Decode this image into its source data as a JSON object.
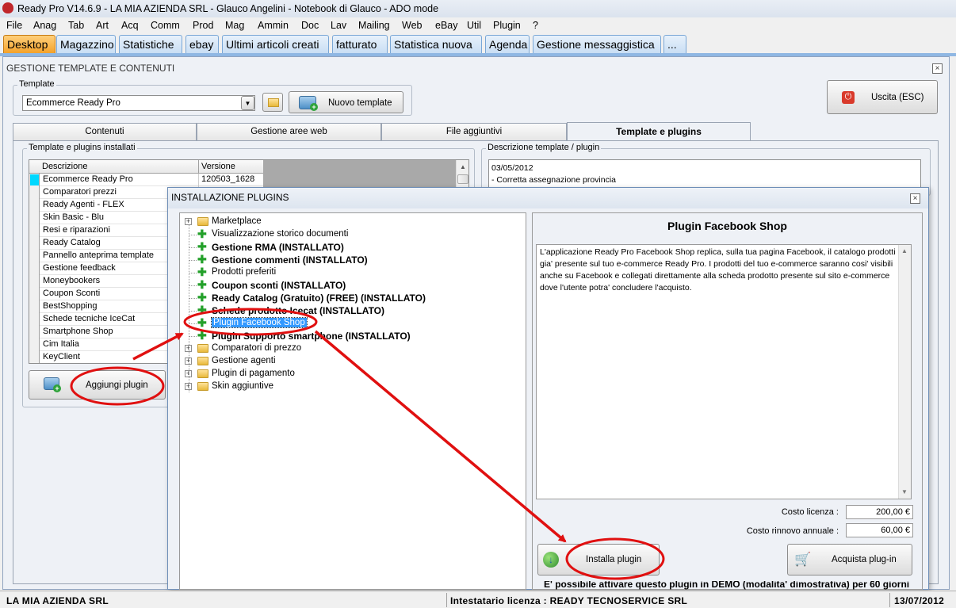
{
  "window": {
    "title": "Ready Pro V14.6.9 - LA MIA AZIENDA SRL - Glauco Angelini - Notebook di Glauco - ADO mode"
  },
  "menu": [
    "File",
    "Anag",
    "Tab",
    "Art",
    "Acq",
    "Comm",
    "Prod",
    "Mag",
    "Ammin",
    "Doc",
    "Lav",
    "Mailing",
    "Web",
    "eBay",
    "Util",
    "Plugin",
    "?"
  ],
  "tabs": [
    "Desktop",
    "Magazzino",
    "Statistiche",
    "ebay",
    "Ultimi articoli creati",
    "fatturato",
    "Statistica nuova",
    "Agenda",
    "Gestione messaggistica",
    "..."
  ],
  "main": {
    "title": "GESTIONE TEMPLATE E CONTENUTI",
    "template_legend": "Template",
    "template_value": "Ecommerce Ready Pro",
    "new_template_label": "Nuovo template",
    "exit_label": "Uscita (ESC)",
    "subtabs": [
      "Contenuti",
      "Gestione aree web",
      "File aggiuntivi",
      "Template e plugins"
    ],
    "installed_legend": "Template e plugins installati",
    "desc_legend": "Descrizione template / plugin",
    "columns": [
      "Descrizione",
      "Versione"
    ],
    "rows": [
      {
        "name": "Ecommerce Ready Pro",
        "version": "120503_1628"
      },
      {
        "name": "Comparatori prezzi",
        "version": ""
      },
      {
        "name": "Ready Agenti - FLEX",
        "version": ""
      },
      {
        "name": "Skin Basic - Blu",
        "version": ""
      },
      {
        "name": "Resi e riparazioni",
        "version": ""
      },
      {
        "name": "Ready Catalog",
        "version": ""
      },
      {
        "name": "Pannello anteprima template",
        "version": ""
      },
      {
        "name": "Gestione feedback",
        "version": ""
      },
      {
        "name": "Moneybookers",
        "version": ""
      },
      {
        "name": "Coupon Sconti",
        "version": ""
      },
      {
        "name": "BestShopping",
        "version": ""
      },
      {
        "name": "Schede tecniche IceCat",
        "version": ""
      },
      {
        "name": "Smartphone Shop",
        "version": ""
      },
      {
        "name": "Cim Italia",
        "version": ""
      },
      {
        "name": "KeyClient",
        "version": ""
      }
    ],
    "desc_lines": [
      "03/05/2012",
      "- Corretta assegnazione provincia"
    ],
    "add_plugin_label": "Aggiungi plugin"
  },
  "dialog": {
    "title": "INSTALLAZIONE PLUGINS",
    "tree": [
      {
        "label": "Marketplace",
        "kind": "folder",
        "bold": false
      },
      {
        "label": "Visualizzazione storico documenti",
        "kind": "plugin",
        "bold": false
      },
      {
        "label": "Gestione RMA (INSTALLATO)",
        "kind": "plugin",
        "bold": true
      },
      {
        "label": "Gestione commenti (INSTALLATO)",
        "kind": "plugin",
        "bold": true
      },
      {
        "label": "Prodotti preferiti",
        "kind": "plugin",
        "bold": false
      },
      {
        "label": "Coupon sconti (INSTALLATO)",
        "kind": "plugin",
        "bold": true
      },
      {
        "label": "Ready Catalog (Gratuito) (FREE) (INSTALLATO)",
        "kind": "plugin",
        "bold": true
      },
      {
        "label": "Schede prodotto Icecat (INSTALLATO)",
        "kind": "plugin",
        "bold": true
      },
      {
        "label": "Plugin Facebook Shop",
        "kind": "plugin",
        "bold": false,
        "selected": true
      },
      {
        "label": "Plugin Supporto smartphone (INSTALLATO)",
        "kind": "plugin",
        "bold": true
      },
      {
        "label": "Comparatori di prezzo",
        "kind": "folder",
        "bold": false
      },
      {
        "label": "Gestione agenti",
        "kind": "folder",
        "bold": false
      },
      {
        "label": "Plugin di pagamento",
        "kind": "folder",
        "bold": false
      },
      {
        "label": "Skin aggiuntive",
        "kind": "folder",
        "bold": false
      }
    ],
    "plugin_title": "Plugin Facebook Shop",
    "plugin_desc": "L'applicazione Ready Pro Facebook Shop replica, sulla tua pagina Facebook, il catalogo prodotti gia' presente sul tuo e-commerce Ready Pro. I prodotti del tuo e-commerce saranno cosi' visibili anche su Facebook e collegati direttamente alla scheda prodotto presente sul sito e-commerce dove l'utente potra' concludere l'acquisto.",
    "license_cost_label": "Costo licenza :",
    "license_cost": "200,00 €",
    "renewal_label": "Costo rinnovo annuale :",
    "renewal_cost": "60,00 €",
    "install_label": "Installa plugin",
    "buy_label": "Acquista plug-in",
    "demo_note": "E' possibile attivare questo plugin in DEMO (modalita' dimostrativa) per 60 giorni"
  },
  "status": {
    "company": "LA MIA AZIENDA SRL",
    "license": "Intestatario licenza : READY TECNOSERVICE SRL",
    "date": "13/07/2012"
  },
  "colors": {
    "annotation_red": "#e01010",
    "selection_blue": "#3399ff",
    "active_tab": "#f4a22b"
  }
}
